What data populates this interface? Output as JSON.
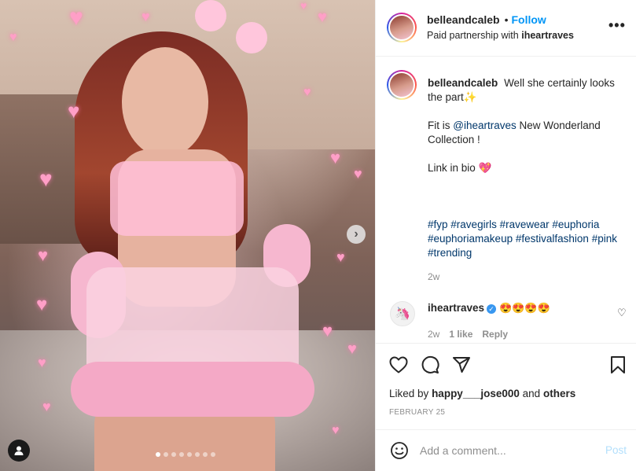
{
  "post": {
    "username": "belleandcaleb",
    "follow_label": "Follow",
    "bullet": "•",
    "partnership_prefix": "Paid partnership with",
    "partner": "iheartraves",
    "more_icon": "•••"
  },
  "photo": {
    "carousel_count": 8,
    "active_index": 0,
    "next_icon": "›",
    "heart_glyph": "♥"
  },
  "caption": {
    "username": "belleandcaleb",
    "line1": "Well she certainly looks the part✨",
    "fit_prefix": "Fit is ",
    "fit_mention": "@iheartraves",
    "fit_suffix": " New Wonderland Collection !",
    "link": "Link in bio 💖",
    "hashtags": [
      "#fyp",
      "#ravegirls",
      "#ravewear",
      "#euphoria",
      "#euphoriamakeup",
      "#festivalfashion",
      "#pink",
      "#trending"
    ],
    "time": "2w"
  },
  "reply": {
    "username": "iheartraves",
    "verified_mark": "✓",
    "text": "😍😍😍😍",
    "avatar_glyph": "🦄",
    "time": "2w",
    "likes": "1 like",
    "reply_label": "Reply",
    "heart_icon": "♡"
  },
  "engagement": {
    "liked_by_prefix": "Liked by",
    "liked_by_user": "happy___jose000",
    "liked_by_and": "and",
    "liked_by_others": "others",
    "date": "FEBRUARY 25"
  },
  "add_comment": {
    "placeholder": "Add a comment...",
    "post_label": "Post"
  },
  "colors": {
    "link_blue": "#0095f6",
    "hashtag_blue": "#00376b",
    "muted": "#8e8e8e",
    "post_disabled": "#b2dffc"
  }
}
